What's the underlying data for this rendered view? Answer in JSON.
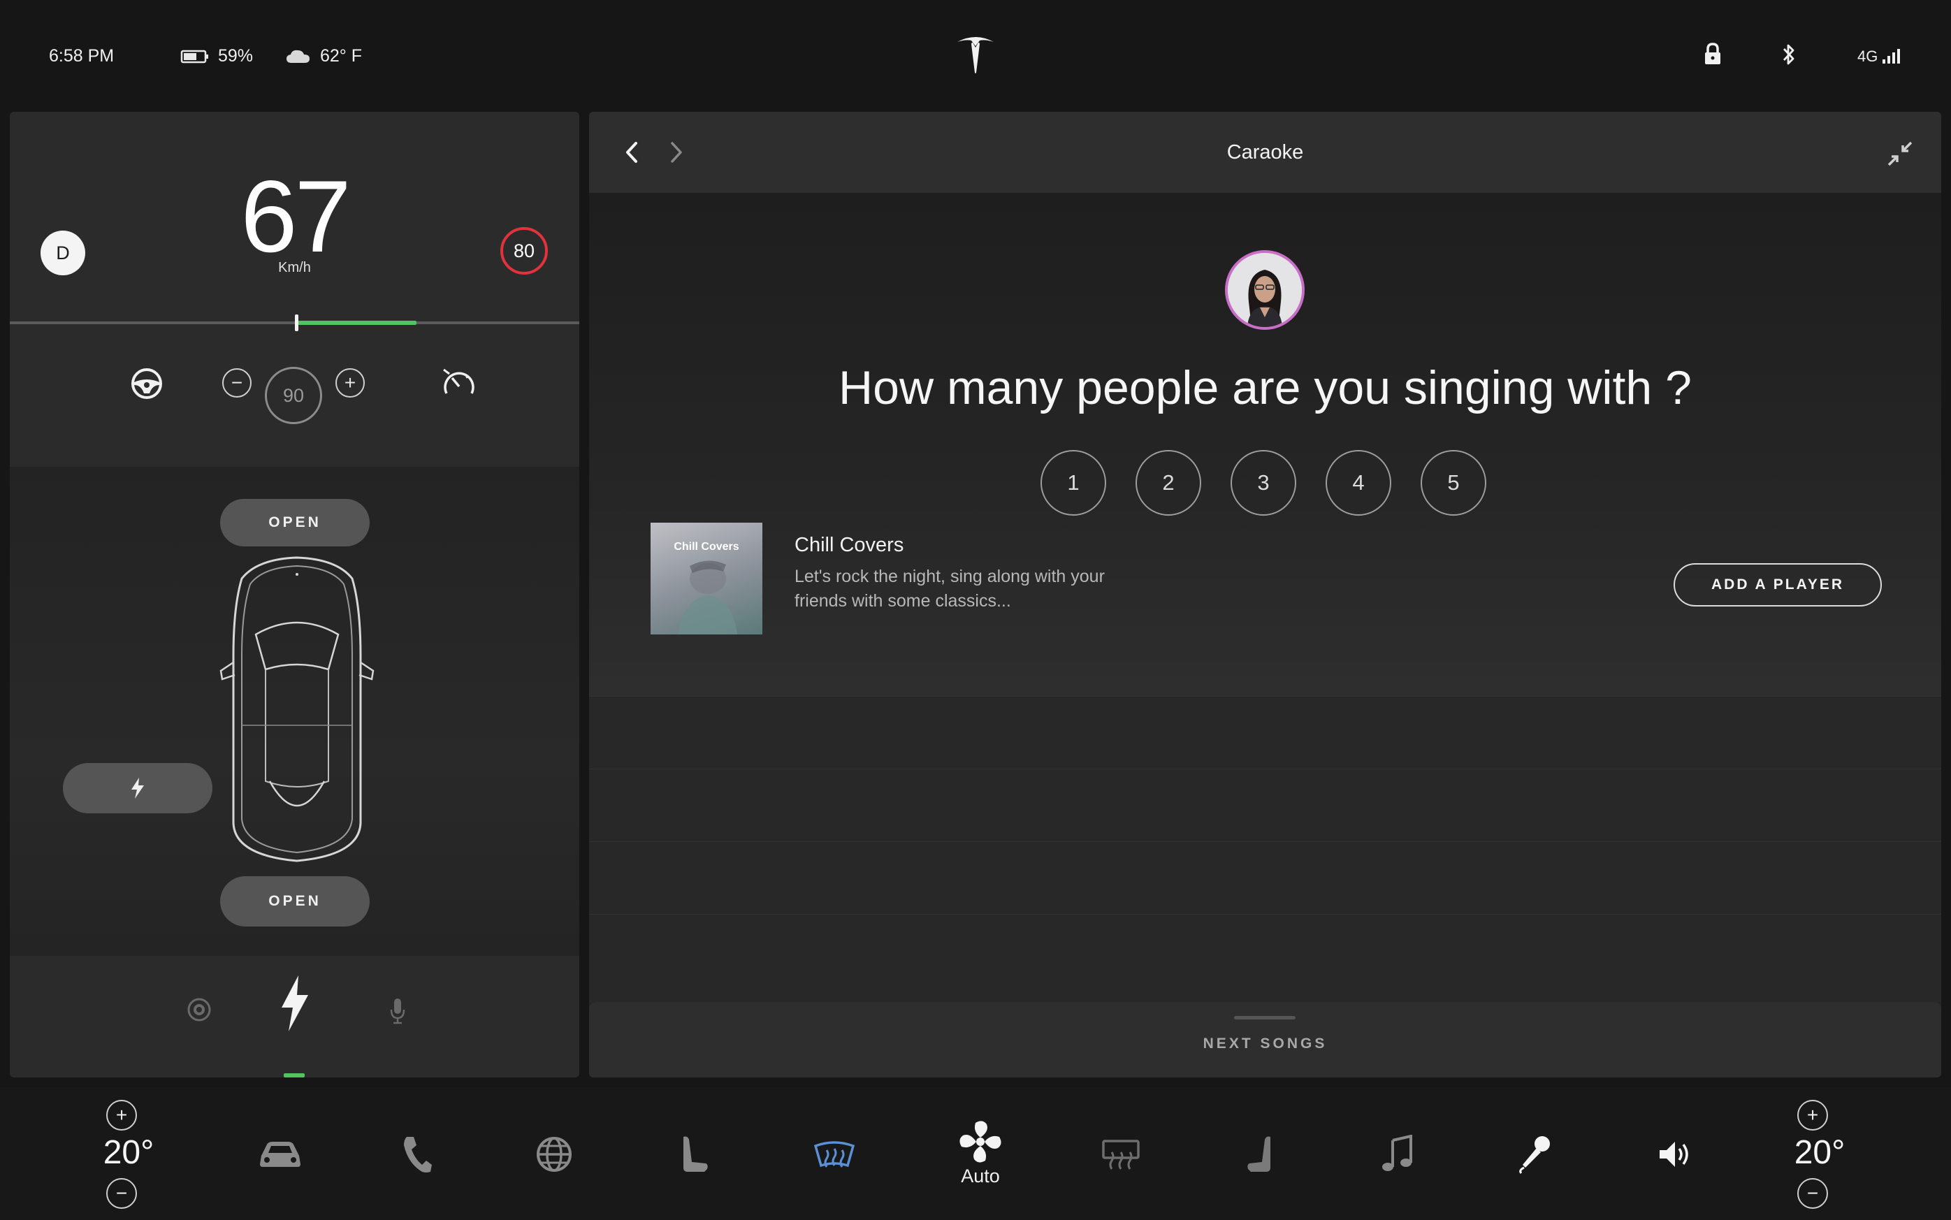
{
  "status_bar": {
    "time": "6:58 PM",
    "battery_percent": "59%",
    "weather_temp": "62° F",
    "network": "4G"
  },
  "drive": {
    "gear": "D",
    "speed": "67",
    "unit": "Km/h",
    "speed_limit": "80",
    "set_speed": "90",
    "minus": "−",
    "plus": "+"
  },
  "car": {
    "frunk_label": "OPEN",
    "trunk_label": "OPEN"
  },
  "app": {
    "title": "Caraoke",
    "question": "How many people are you singing with ?",
    "player_counts": [
      "1",
      "2",
      "3",
      "4",
      "5"
    ],
    "playlist": {
      "cover_label": "Chill Covers",
      "title": "Chill Covers",
      "description": "Let's rock the night,  sing along with your friends with some classics..."
    },
    "add_player_label": "ADD A PLAYER",
    "next_songs_label": "NEXT SONGS"
  },
  "dock": {
    "left_temp": "20°",
    "right_temp": "20°",
    "fan_mode": "Auto",
    "plus": "+",
    "minus": "−"
  },
  "colors": {
    "accent_green": "#4fc45f",
    "speed_limit_red": "#e0333b",
    "defrost_blue": "#5b8fd6",
    "avatar_ring": "#c86ec9"
  },
  "icons": [
    "battery-icon",
    "cloud-icon",
    "tesla-logo",
    "lock-icon",
    "bluetooth-icon",
    "signal-icon",
    "steering-wheel-icon",
    "speedometer-icon",
    "lightning-icon",
    "camera-icon",
    "microphone-icon",
    "car-icon",
    "phone-icon",
    "globe-icon",
    "seat-icon",
    "front-defrost-icon",
    "fan-icon",
    "rear-defrost-icon",
    "seat-heat-icon",
    "music-note-icon",
    "karaoke-mic-icon",
    "volume-icon"
  ]
}
